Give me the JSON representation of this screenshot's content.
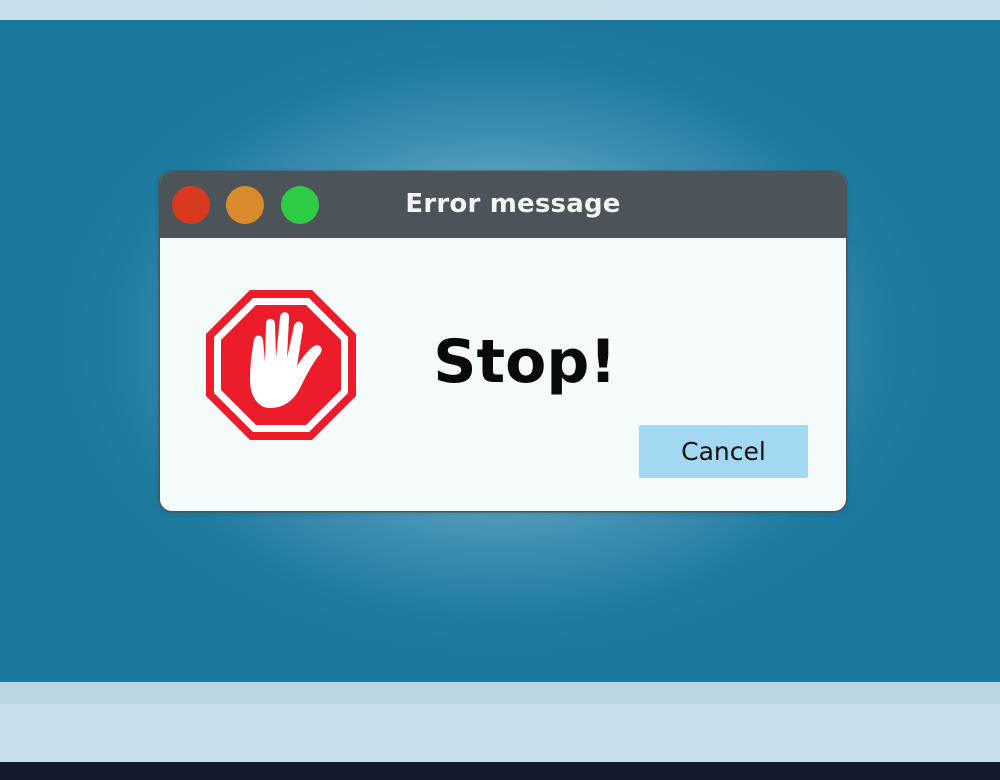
{
  "window": {
    "title": "Error message",
    "controls": {
      "close_color": "#d93a1f",
      "minimize_color": "#da8b2b",
      "maximize_color": "#2ecb45"
    }
  },
  "dialog": {
    "icon": "stop-hand-icon",
    "icon_color": "#ec1c2b",
    "message": "Stop!",
    "cancel_label": "Cancel",
    "cancel_color": "#a2d8f1"
  },
  "colors": {
    "background": "#1b789e",
    "titlebar": "#4c5459",
    "window_body": "#f5fbfa"
  }
}
